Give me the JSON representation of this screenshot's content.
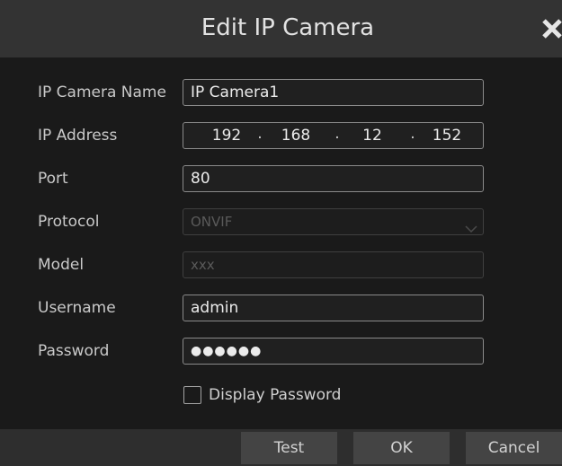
{
  "dialog": {
    "title": "Edit IP Camera"
  },
  "form": {
    "ip_camera_name": {
      "label": "IP Camera Name",
      "value": "IP Camera1"
    },
    "ip_address": {
      "label": "IP Address",
      "octets": [
        "192",
        "168",
        "12",
        "152"
      ],
      "separator": "."
    },
    "port": {
      "label": "Port",
      "value": "80"
    },
    "protocol": {
      "label": "Protocol",
      "value": "ONVIF"
    },
    "model": {
      "label": "Model",
      "value": "xxx"
    },
    "username": {
      "label": "Username",
      "value": "admin"
    },
    "password": {
      "label": "Password",
      "value": "●●●●●●"
    },
    "display_password": {
      "label": "Display Password",
      "checked": false
    }
  },
  "buttons": {
    "test": "Test",
    "ok": "OK",
    "cancel": "Cancel"
  },
  "icons": {
    "close": "close-icon",
    "dropdown": "chevron-down-icon"
  },
  "colors": {
    "background": "#1a1a1a",
    "titlebar": "#333333",
    "button": "#444444",
    "field_border": "#8a8a8a"
  }
}
